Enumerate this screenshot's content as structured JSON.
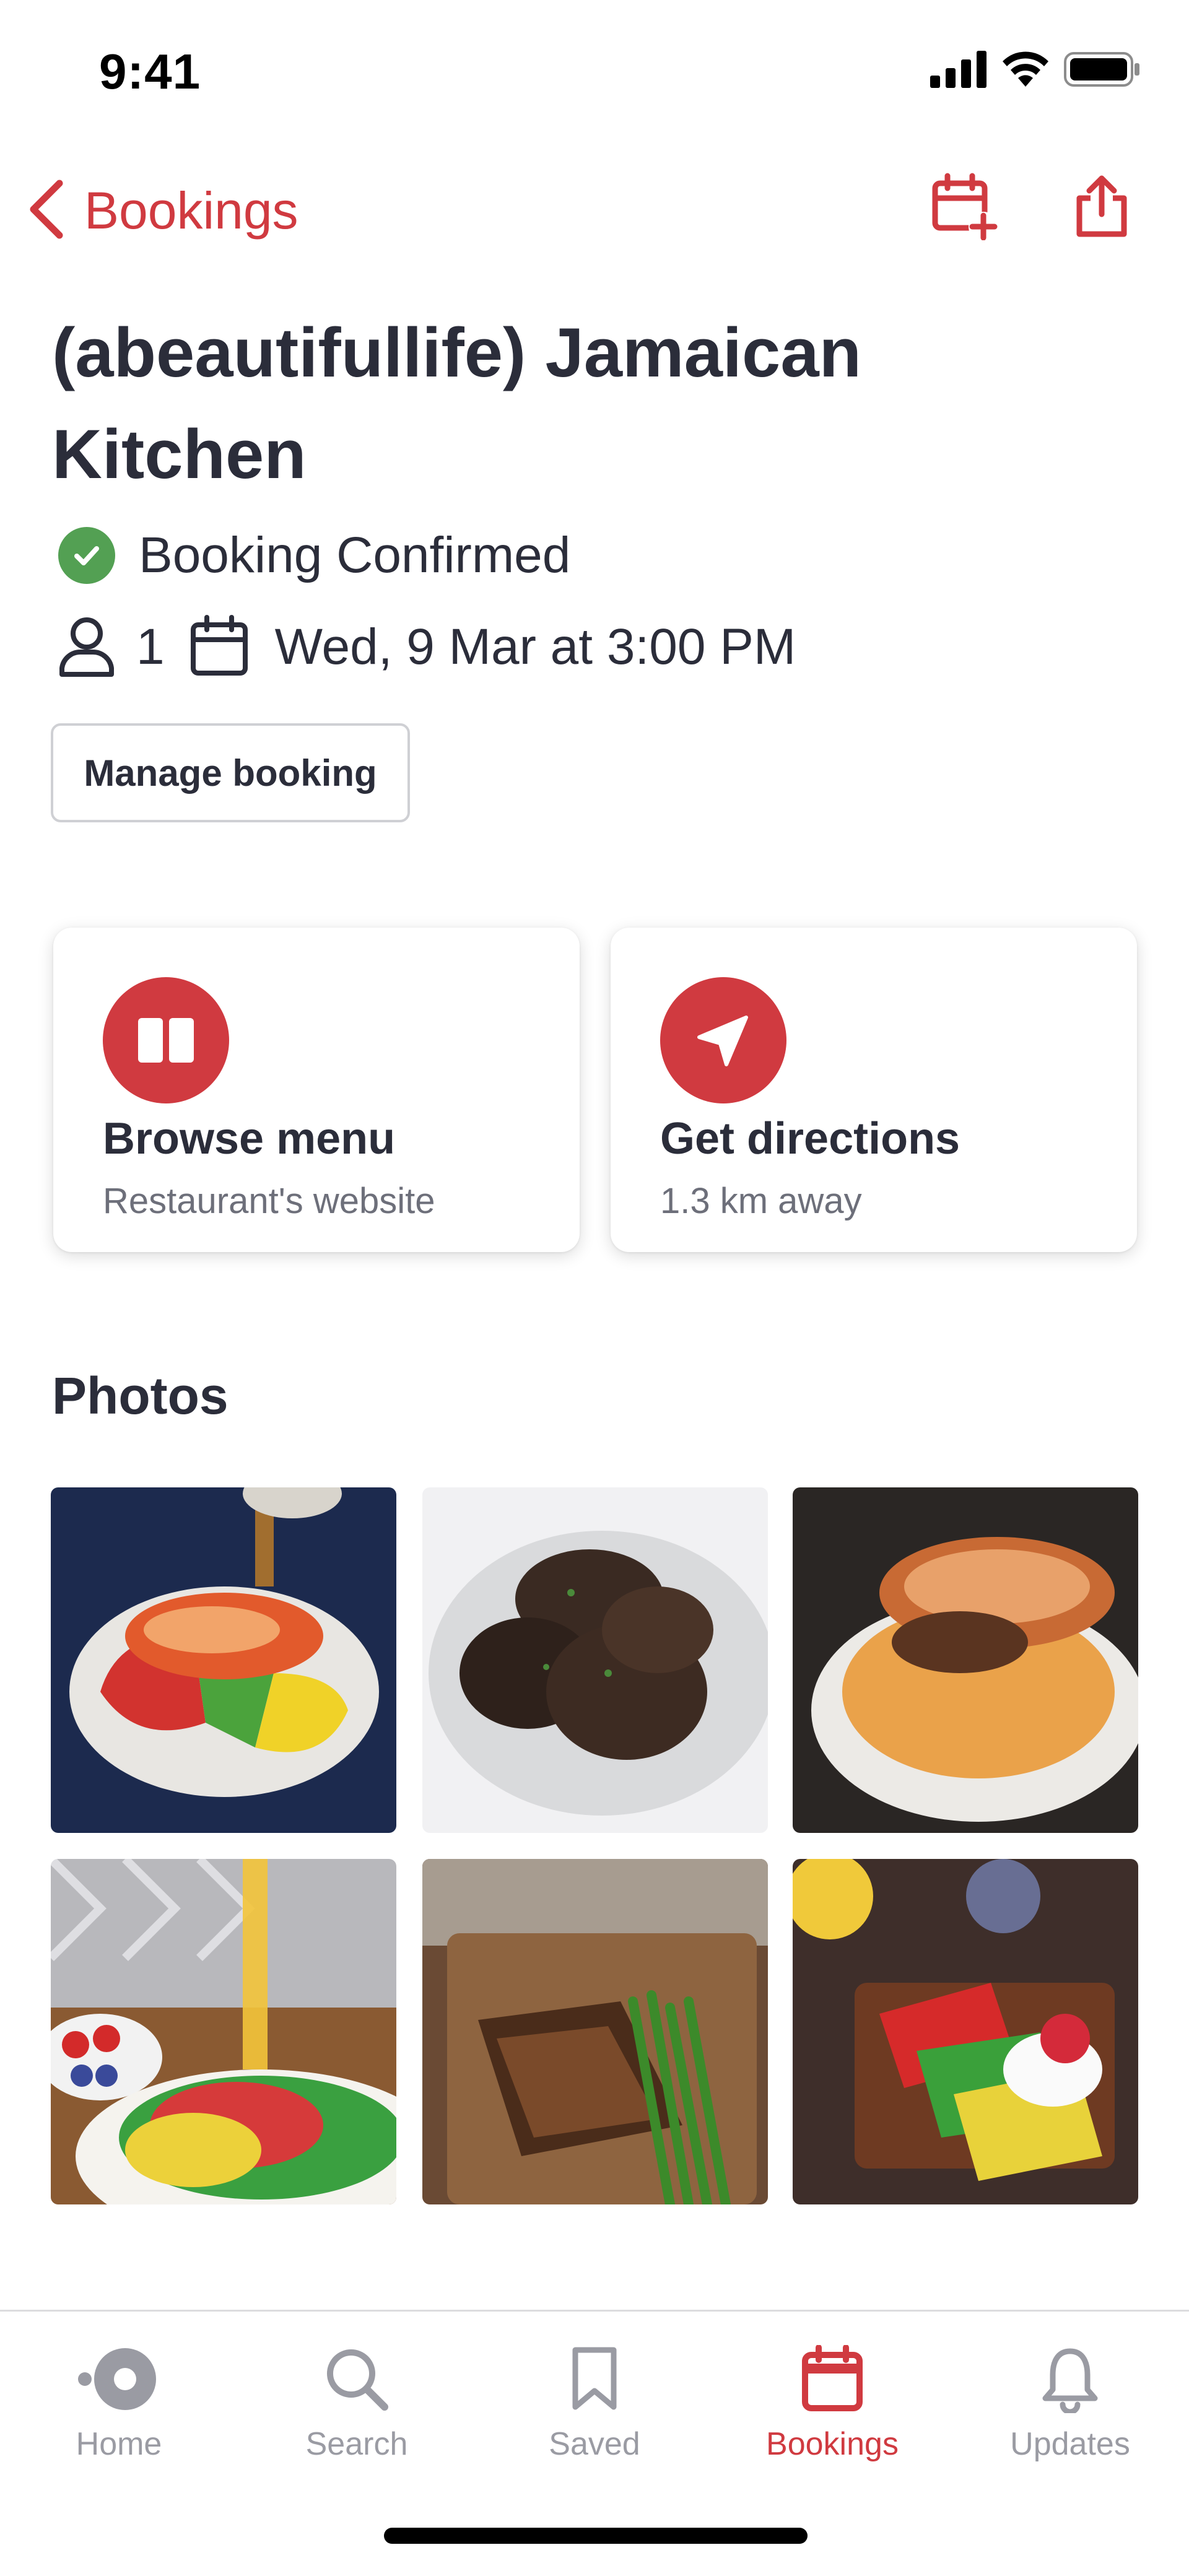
{
  "status_bar": {
    "time": "9:41",
    "icons": [
      "cellular-signal-icon",
      "wifi-icon",
      "battery-icon"
    ]
  },
  "nav": {
    "back_label": "Bookings",
    "actions": [
      "add-to-calendar-icon",
      "share-icon"
    ]
  },
  "booking": {
    "title": "(abeautifullife) Jamaican Kitchen",
    "status": "Booking Confirmed",
    "party_size": "1",
    "datetime": "Wed, 9 Mar at 3:00 PM",
    "manage_label": "Manage booking"
  },
  "cards": [
    {
      "icon": "book-icon",
      "title": "Browse menu",
      "subtitle": "Restaurant's website"
    },
    {
      "icon": "navigation-arrow-icon",
      "title": "Get directions",
      "subtitle": "1.3 km away"
    }
  ],
  "photos": {
    "title": "Photos",
    "items": [
      {
        "name": "lobster-tail-on-waffles"
      },
      {
        "name": "jerk-chicken"
      },
      {
        "name": "lobster-with-mac-and-cheese"
      },
      {
        "name": "rainbow-waffles-with-fruit"
      },
      {
        "name": "blackened-fish-with-green-beans"
      },
      {
        "name": "rainbow-waffles-with-cream"
      }
    ]
  },
  "tabbar": {
    "active": "Bookings",
    "tabs": [
      {
        "label": "Home",
        "icon": "home-dots-icon"
      },
      {
        "label": "Search",
        "icon": "search-icon"
      },
      {
        "label": "Saved",
        "icon": "bookmark-icon"
      },
      {
        "label": "Bookings",
        "icon": "calendar-icon"
      },
      {
        "label": "Updates",
        "icon": "bell-icon"
      }
    ]
  },
  "colors": {
    "accent": "#d03a40",
    "confirmed": "#53a053",
    "text": "#2b2d3a",
    "muted": "#6d6f7a",
    "tab_inactive": "#9a9ba3"
  }
}
